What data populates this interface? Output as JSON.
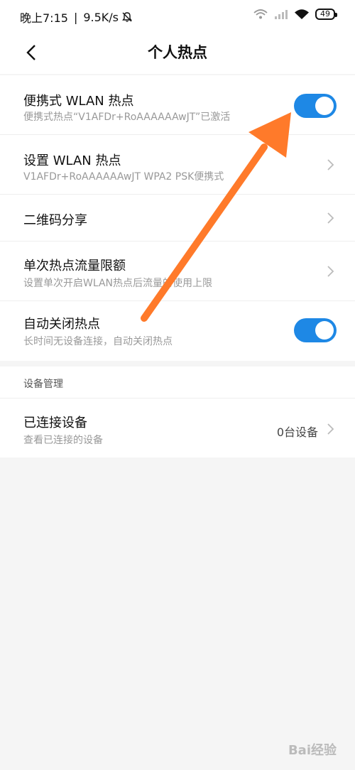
{
  "status_bar": {
    "time": "晚上7:15",
    "speed": "9.5K/s",
    "battery": "49"
  },
  "header": {
    "title": "个人热点"
  },
  "rows": [
    {
      "title": "便携式 WLAN 热点",
      "subtitle": "便携式热点“V1AFDr+RoAAAAAAwJT”已激活",
      "toggle_on": true
    },
    {
      "title": "设置 WLAN 热点",
      "subtitle": "V1AFDr+RoAAAAAAwJT WPA2 PSK便携式"
    },
    {
      "title": "二维码分享"
    },
    {
      "title": "单次热点流量限额",
      "subtitle": "设置单次开启WLAN热点后流量的使用上限"
    },
    {
      "title": "自动关闭热点",
      "subtitle": "长时间无设备连接，自动关闭热点",
      "toggle_on": true
    }
  ],
  "device_section": {
    "label": "设备管理",
    "row": {
      "title": "已连接设备",
      "subtitle": "查看已连接的设备",
      "value": "0台设备"
    }
  },
  "watermark": "Bai经验",
  "colors": {
    "toggle_on": "#1e88e5",
    "arrow": "#ff7a2a",
    "background": "#f5f5f5"
  }
}
